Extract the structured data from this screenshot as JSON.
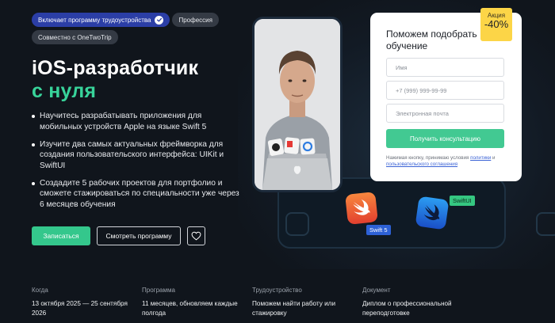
{
  "badges": [
    {
      "label": "Включает программу трудоустройства",
      "verified": true
    },
    {
      "label": "Профессия"
    },
    {
      "label": "Совместно с OneTwoTrip"
    }
  ],
  "hero": {
    "title_line1": "iOS-разработчик",
    "title_line2": "с нуля"
  },
  "features": [
    "Научитесь разрабатывать приложения для мобильных устройств Apple на языке Swift 5",
    "Изучите два самых актуальных фреймворка для создания пользовательского интерфейса: UIKit и SwiftUI",
    "Создадите 5 рабочих проектов для портфолио и сможете стажироваться по специальности уже через 6 месяцев обучения"
  ],
  "actions": {
    "enroll_label": "Записаться",
    "program_label": "Смотреть программу",
    "favorite_icon": "heart-icon"
  },
  "illustration": {
    "tag_swift5": "Swift 5",
    "tag_swiftui": "SwiftUI"
  },
  "form": {
    "title": "Поможем подобрать обучение",
    "promo_label": "Акция",
    "promo_value": "-40%",
    "name_placeholder": "Имя",
    "phone_placeholder": "+7 (999) 999-99-99",
    "email_placeholder": "Электронная почта",
    "submit_label": "Получить консультацию",
    "consent_prefix": "Нажимая кнопку, принимаю условия ",
    "consent_link1": "политики",
    "consent_middle": " и ",
    "consent_link2": "пользовательского соглашения"
  },
  "facts": [
    {
      "label": "Когда",
      "value": "13 октября 2025 — 25 сентября 2026"
    },
    {
      "label": "Программа",
      "value": "11 месяцев, обновляем каждые полгода"
    },
    {
      "label": "Трудоустройство",
      "value": "Поможем найти работу или стажировку"
    },
    {
      "label": "Документ",
      "value": "Диплом о профессиональной переподготовке"
    }
  ],
  "colors": {
    "background": "#10151c",
    "accent_green": "#38d39a",
    "badge_blue": "#2b3ea6",
    "promo_yellow": "#fcd547"
  }
}
